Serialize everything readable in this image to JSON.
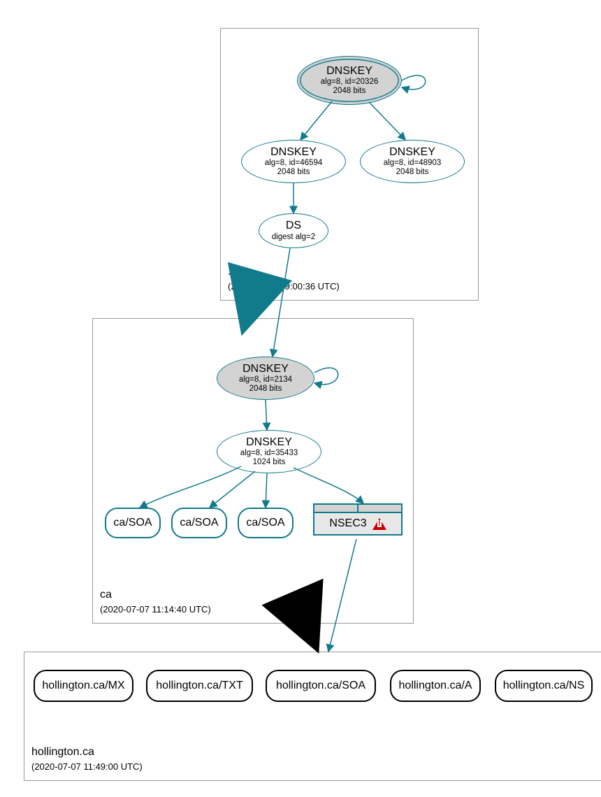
{
  "zones": {
    "root": {
      "name": ".",
      "time": "(2020-07-07 09:00:36 UTC)"
    },
    "ca": {
      "name": "ca",
      "time": "(2020-07-07 11:14:40 UTC)"
    },
    "hollington": {
      "name": "hollington.ca",
      "time": "(2020-07-07 11:49:00 UTC)"
    }
  },
  "nodes": {
    "root_ksk": {
      "title": "DNSKEY",
      "line2": "alg=8, id=20326",
      "line3": "2048 bits"
    },
    "root_zsk1": {
      "title": "DNSKEY",
      "line2": "alg=8, id=46594",
      "line3": "2048 bits"
    },
    "root_zsk2": {
      "title": "DNSKEY",
      "line2": "alg=8, id=48903",
      "line3": "2048 bits"
    },
    "root_ds": {
      "title": "DS",
      "line2": "digest alg=2"
    },
    "ca_ksk": {
      "title": "DNSKEY",
      "line2": "alg=8, id=2134",
      "line3": "2048 bits"
    },
    "ca_zsk": {
      "title": "DNSKEY",
      "line2": "alg=8, id=35433",
      "line3": "1024 bits"
    },
    "soa1": {
      "label": "ca/SOA"
    },
    "soa2": {
      "label": "ca/SOA"
    },
    "soa3": {
      "label": "ca/SOA"
    },
    "nsec3": {
      "label": "NSEC3"
    },
    "h_mx": {
      "label": "hollington.ca/MX"
    },
    "h_txt": {
      "label": "hollington.ca/TXT"
    },
    "h_soa": {
      "label": "hollington.ca/SOA"
    },
    "h_a": {
      "label": "hollington.ca/A"
    },
    "h_ns": {
      "label": "hollington.ca/NS"
    }
  }
}
